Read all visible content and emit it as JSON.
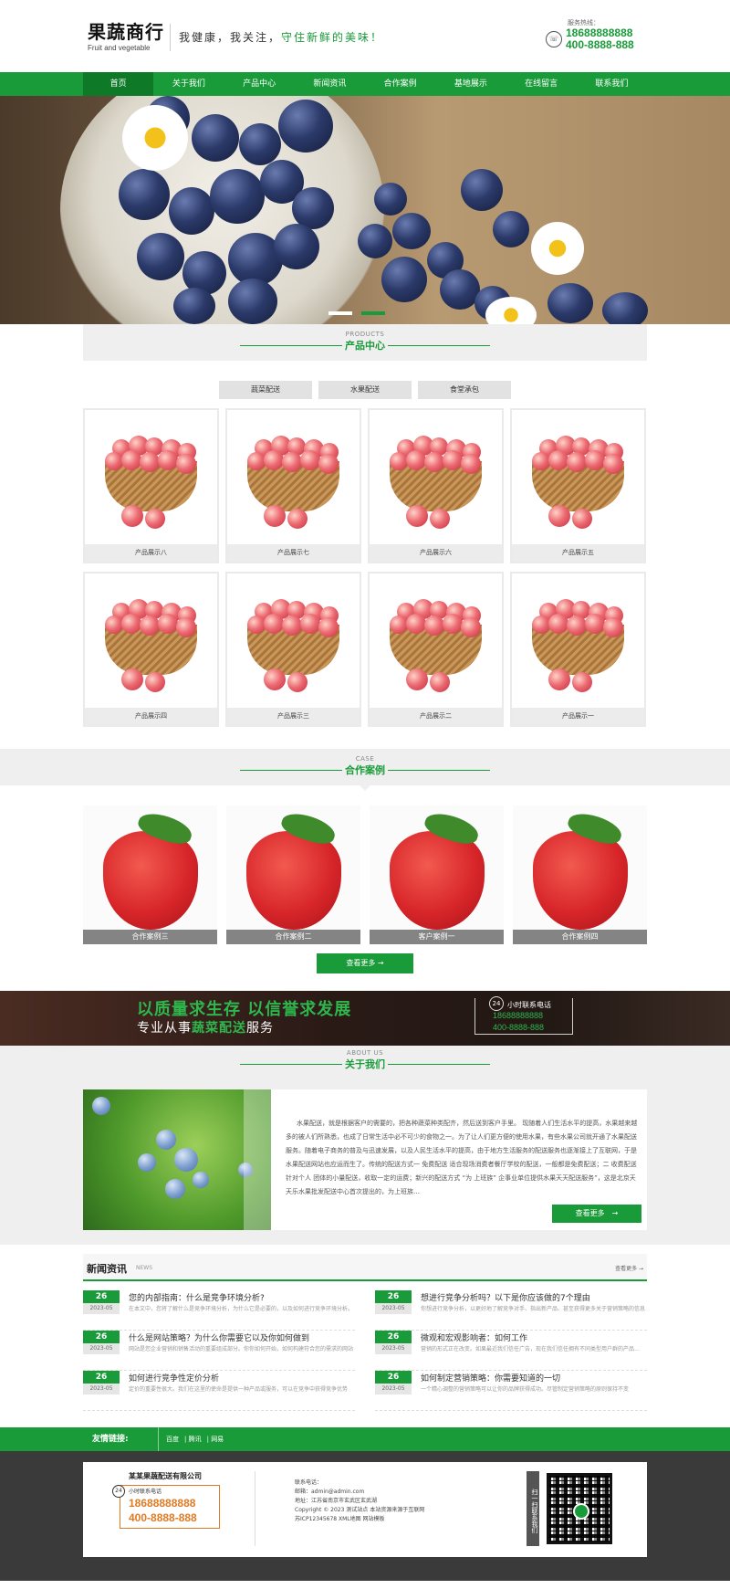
{
  "header": {
    "logo_main": "果蔬商行",
    "logo_sub": "Fruit and vegetable",
    "slogan_part1": "我健康，我关注，",
    "slogan_part2": "守住新鲜的美味！",
    "hotline_label": "服务热线：",
    "hotline_mobile": "18688888888",
    "hotline_phone": "400-8888-888"
  },
  "nav": {
    "items": [
      "首页",
      "关于我们",
      "产品中心",
      "新闻资讯",
      "合作案例",
      "基地展示",
      "在线留言",
      "联系我们"
    ]
  },
  "products": {
    "title_en": "PRODUCTS",
    "title_cn": "产品中心",
    "tabs": [
      "蔬菜配送",
      "水果配送",
      "食堂承包"
    ],
    "items": [
      "产品展示八",
      "产品展示七",
      "产品展示六",
      "产品展示五",
      "产品展示四",
      "产品展示三",
      "产品展示二",
      "产品展示一"
    ]
  },
  "cases": {
    "title_en": "CASE",
    "title_cn": "合作案例",
    "items": [
      "合作案例三",
      "合作案例二",
      "客户案例一",
      "合作案例四"
    ],
    "more": "查看更多 →"
  },
  "slogan_banner": {
    "line1": "以质量求生存 以信誉求发展",
    "line2_a": "专业从事",
    "line2_b": "蔬菜配送",
    "line2_c": "服务",
    "badge": "24",
    "label": "小时联系电话",
    "mobile": "18688888888",
    "phone": "400-8888-888"
  },
  "about": {
    "title_en": "ABOUT US",
    "title_cn": "关于我们",
    "text": "水果配送，就是根据客户的需要的，把各种蔬菜种类配齐，然后送到客户手里。 现随着人们生活水平的提高，水果越来越多的被人们所熟悉，也成了日常生活中必不可少的食物之一。为了让人们更方便的使用水果，有些水果公司就开通了水果配送服务。随着电子商务的普及与迅速发展，以及人民生活水平的提高，由于地方生活服务的配送服务也逐渐接上了互联网，于是水果配送网站也应运而生了。传统的配送方式一 免费配送 适合现场消费者餐厅学校的配送，一般都是免费配送；二 收费配送 针对个人 团体的小量配送，收取一定的运费；新兴的配送方式 “为 上班族” 企事业单位提供水果天天配送服务”，这是北京天天乐水果批发配送中心首次提出的，为上班族…",
    "more": "查看更多　→"
  },
  "news": {
    "title": "新闻资讯",
    "title_en": "NEWS",
    "more": "查看更多 →",
    "items": [
      {
        "day": "26",
        "date": "2023-05",
        "title": "您的内部指南：什么是竞争环境分析?",
        "summary": "在本文中，您将了解什么是竞争环境分析，为什么它是必要的，以及如何进行竞争环境分析。"
      },
      {
        "day": "26",
        "date": "2023-05",
        "title": "想进行竞争分析吗？以下是你应该做的7个理由",
        "summary": "你想进行竞争分析，以更好地了解竞争对手、指出新产品、甚至获得更多关于营销策略的信息"
      },
      {
        "day": "26",
        "date": "2023-05",
        "title": "什么是网站策略？为什么你需要它以及你如何做到",
        "summary": "网站是您企业营销和销售活动的重要组成部分。你你如何开始，如何构建符合您的需求的网站"
      },
      {
        "day": "26",
        "date": "2023-05",
        "title": "微观和宏观影响者：如何工作",
        "summary": "营销的形式正在改变。如果最近我们信任广告，现在我们信任拥有不同类型用户群的产品和服务"
      },
      {
        "day": "26",
        "date": "2023-05",
        "title": "如何进行竞争性定价分析",
        "summary": "定价的重要性很大。我们在这里的使命是提供一种产品或服务，可以在竞争中获得竞争优势"
      },
      {
        "day": "26",
        "date": "2023-05",
        "title": "如何制定营销策略：你需要知道的一切",
        "summary": "一个精心调整的营销策略可以让你的品牌获得成功。尽管制定营销策略的原则保持不变"
      }
    ]
  },
  "links": {
    "label": "友情链接:",
    "items": [
      "百度",
      "腾讯",
      "网易"
    ]
  },
  "footer": {
    "company": "某某果蔬配送有限公司",
    "badge": "24",
    "phone_label": "小时联系电话",
    "mobile": "18688888888",
    "phone": "400-8888-888",
    "info_title": "联系电话：",
    "email": "邮箱：admin@admin.com",
    "address": "地址：江苏省南京市玄武区玄武湖",
    "copyright": "Copyright © 2023 测试站点 本站资源来源于互联网",
    "icp": "苏ICP12345678 XML地图 网站模板",
    "qr_label": "扫一扫联系我们"
  },
  "colors": {
    "brand_green": "#1a9b39",
    "accent_orange": "#e07b25",
    "footer_bg": "#3a3a3a"
  }
}
